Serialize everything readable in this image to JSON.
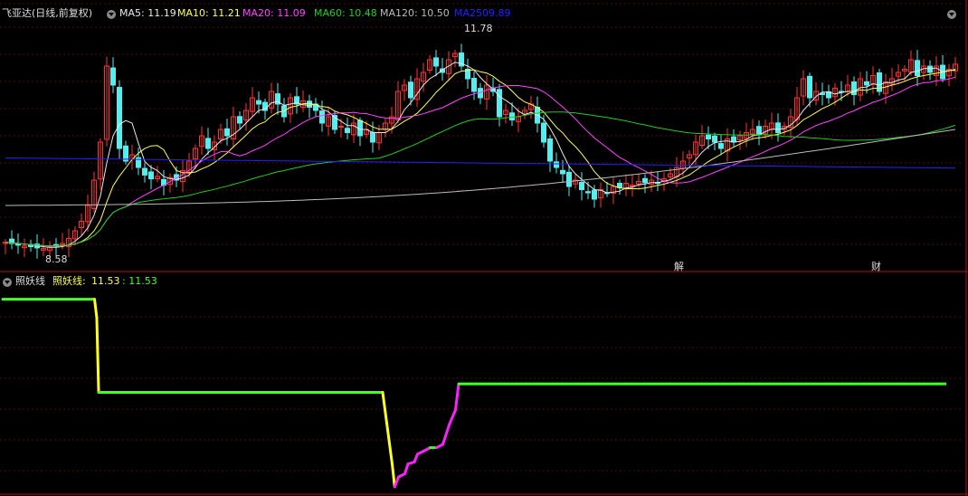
{
  "main_panel": {
    "stock": "飞亚达(日线,前复权)",
    "ma": [
      {
        "label": "MA5: 11.19",
        "color": "#e8e8e8",
        "period": 5
      },
      {
        "label": "MA10: 11.21",
        "color": "#ffff55",
        "period": 10
      },
      {
        "label": "MA20: 11.09",
        "color": "#ff44ff",
        "period": 20
      },
      {
        "label": "MA60: 10.48",
        "color": "#22cc22",
        "period": 60
      },
      {
        "label": "MA120: 10.50",
        "color": "#bbbbbb",
        "period": 120
      },
      {
        "label": "MA250",
        "color": "#2222ff",
        "period": 250
      },
      {
        "label": "9.89",
        "color": "#2222ff"
      }
    ],
    "high_label": "11.78",
    "low_label": "8.58",
    "markers": [
      "解",
      "财"
    ]
  },
  "sub_panel": {
    "title": "照妖线",
    "indicator_name": "照妖线:",
    "value1": "11.53",
    "value2": ": 11.53"
  },
  "chart_data": [
    {
      "type": "candlestick",
      "title": "飞亚达(日线,前复权)",
      "ylim": [
        8.4,
        12.2
      ],
      "colors": {
        "up": "#ff3333",
        "down": "#55eeee"
      },
      "series": [
        {
          "name": "MA5",
          "value": 11.19
        },
        {
          "name": "MA10",
          "value": 11.21
        },
        {
          "name": "MA20",
          "value": 11.09
        },
        {
          "name": "MA60",
          "value": 10.48
        },
        {
          "name": "MA120",
          "value": 10.5
        },
        {
          "name": "MA250",
          "value": 9.89
        }
      ],
      "annotations": [
        {
          "text": "11.78",
          "value": 11.78
        },
        {
          "text": "8.58",
          "value": 8.58
        }
      ],
      "close": [
        8.72,
        8.7,
        8.68,
        8.66,
        8.65,
        8.63,
        8.62,
        8.64,
        8.66,
        8.7,
        8.78,
        8.9,
        9.05,
        9.3,
        9.7,
        10.3,
        11.5,
        11.2,
        10.2,
        10.0,
        10.1,
        9.9,
        9.78,
        9.72,
        9.76,
        9.62,
        9.74,
        9.7,
        9.85,
        10.0,
        10.2,
        10.4,
        10.2,
        10.3,
        10.5,
        10.4,
        10.7,
        10.6,
        10.8,
        11.0,
        10.9,
        10.8,
        11.1,
        10.9,
        10.7,
        11.0,
        10.9,
        10.95,
        10.85,
        10.8,
        10.6,
        10.7,
        10.5,
        10.55,
        10.45,
        10.6,
        10.4,
        10.5,
        10.3,
        10.45,
        10.6,
        10.7,
        11.1,
        11.2,
        11.0,
        11.3,
        11.4,
        11.6,
        11.5,
        11.4,
        11.6,
        11.7,
        11.5,
        11.3,
        11.1,
        11.0,
        11.2,
        11.1,
        10.7,
        10.8,
        10.65,
        10.7,
        10.8,
        10.9,
        10.6,
        10.3,
        10.0,
        9.9,
        9.8,
        9.6,
        9.7,
        9.55,
        9.5,
        9.4,
        9.55,
        9.5,
        9.6,
        9.58,
        9.65,
        9.62,
        9.68,
        9.66,
        9.7,
        9.65,
        9.72,
        9.8,
        9.9,
        10.0,
        10.1,
        10.3,
        10.4,
        10.35,
        10.3,
        10.2,
        10.35,
        10.3,
        10.4,
        10.45,
        10.5,
        10.42,
        10.55,
        10.6,
        10.45,
        10.55,
        10.7,
        11.0,
        11.3,
        11.0,
        11.1,
        11.05,
        11.0,
        11.15,
        11.1,
        11.2,
        11.05,
        11.3,
        11.2,
        11.35,
        11.1,
        11.25,
        11.3,
        11.4,
        11.45,
        11.6,
        11.35,
        11.5,
        11.4,
        11.5,
        11.3,
        11.45,
        11.53
      ]
    },
    {
      "type": "line",
      "title": "照妖线",
      "ylim": [
        9.0,
        12.1
      ],
      "colors": {
        "flat": "#44ff22",
        "falling": "#ffff22",
        "rising": "#ff22ff"
      },
      "x": [
        0,
        29,
        29.7,
        30.3,
        120,
        123,
        123.8,
        125,
        127,
        128,
        130,
        131,
        133,
        135,
        137,
        139,
        141,
        143,
        144,
        148
      ],
      "y": [
        11.98,
        11.98,
        11.7,
        10.55,
        10.55,
        9.45,
        9.1,
        9.25,
        9.3,
        9.45,
        9.48,
        9.6,
        9.65,
        9.7,
        9.7,
        9.75,
        10.05,
        10.28,
        10.68,
        10.68
      ],
      "last_x": 298
    }
  ]
}
